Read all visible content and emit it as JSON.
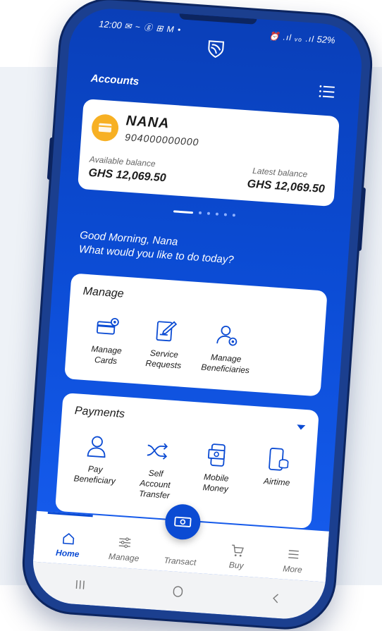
{
  "status_bar": {
    "time": "12:00",
    "left_icons": "✉ ~ ⓖ ⊞ M •",
    "right_icons": "⏰ .ıl ᵥₒ .ıl",
    "battery": "52%"
  },
  "header": {
    "title": "Accounts"
  },
  "account": {
    "name": "NANA",
    "number": "904000000000",
    "available_label": "Available balance",
    "available_value": "GHS 12,069.50",
    "latest_label": "Latest balance",
    "latest_value": "GHS 12,069.50"
  },
  "greeting": {
    "line1": "Good Morning, Nana",
    "line2": "What would you like to do today?"
  },
  "manage": {
    "title": "Manage",
    "items": [
      {
        "line1": "Manage",
        "line2": "Cards",
        "icon": "card-gear-icon"
      },
      {
        "line1": "Service",
        "line2": "Requests",
        "icon": "document-pen-icon"
      },
      {
        "line1": "Manage",
        "line2": "Beneficiaries",
        "icon": "user-gear-icon"
      }
    ]
  },
  "payments": {
    "title": "Payments",
    "items": [
      {
        "line1": "Pay",
        "line2": "Beneficiary",
        "line3": "",
        "icon": "user-icon"
      },
      {
        "line1": "Self",
        "line2": "Account",
        "line3": "Transfer",
        "icon": "transfer-arrows-icon"
      },
      {
        "line1": "Mobile",
        "line2": "Money",
        "line3": "",
        "icon": "mobile-money-icon"
      },
      {
        "line1": "Airtime",
        "line2": "",
        "line3": "",
        "icon": "phone-coins-icon"
      }
    ]
  },
  "bottom_nav": {
    "items": [
      {
        "label": "Home",
        "icon": "home-icon",
        "active": true
      },
      {
        "label": "Manage",
        "icon": "sliders-icon",
        "active": false
      },
      {
        "label": "Transact",
        "icon": "cash-icon",
        "active": false
      },
      {
        "label": "Buy",
        "icon": "cart-icon",
        "active": false
      },
      {
        "label": "More",
        "icon": "hamburger-icon",
        "active": false
      }
    ]
  },
  "colors": {
    "primary": "#0b4bd3",
    "coin": "#f7b023",
    "phone_frame": "#1b3f8f"
  }
}
